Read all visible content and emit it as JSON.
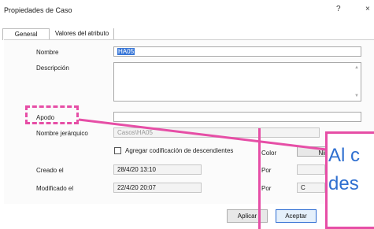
{
  "window": {
    "title": "Propiedades de Caso",
    "help_label": "?",
    "close_label": "×"
  },
  "tabs": [
    "General",
    "Valores del atributo"
  ],
  "form": {
    "nombre_label": "Nombre",
    "nombre_value": "HA05",
    "descripcion_label": "Descripción",
    "descripcion_value": "",
    "apodo_label": "Apodo",
    "apodo_value": "",
    "nombre_jerarquico_label": "Nombre jerárquico",
    "nombre_jerarquico_value": "Casos\\HA05",
    "agregar_label": "Agregar codificación de descendientes",
    "color_label": "Color",
    "color_value": "Ningu",
    "creado_label": "Creado el",
    "creado_value": "28/4/20 13:10",
    "por_label": "Por",
    "creado_por_value": "",
    "modificado_label": "Modificado el",
    "modificado_value": "22/4/20 20:07",
    "modificado_por_value": "C"
  },
  "buttons": {
    "aplicar": "Aplicar",
    "aceptar": "Aceptar"
  },
  "callout": {
    "line1": "Al c",
    "line2": "des"
  },
  "colors": {
    "highlight": "#e64ea6",
    "callout_text": "#2f6fd0",
    "selection": "#3b78d8"
  }
}
